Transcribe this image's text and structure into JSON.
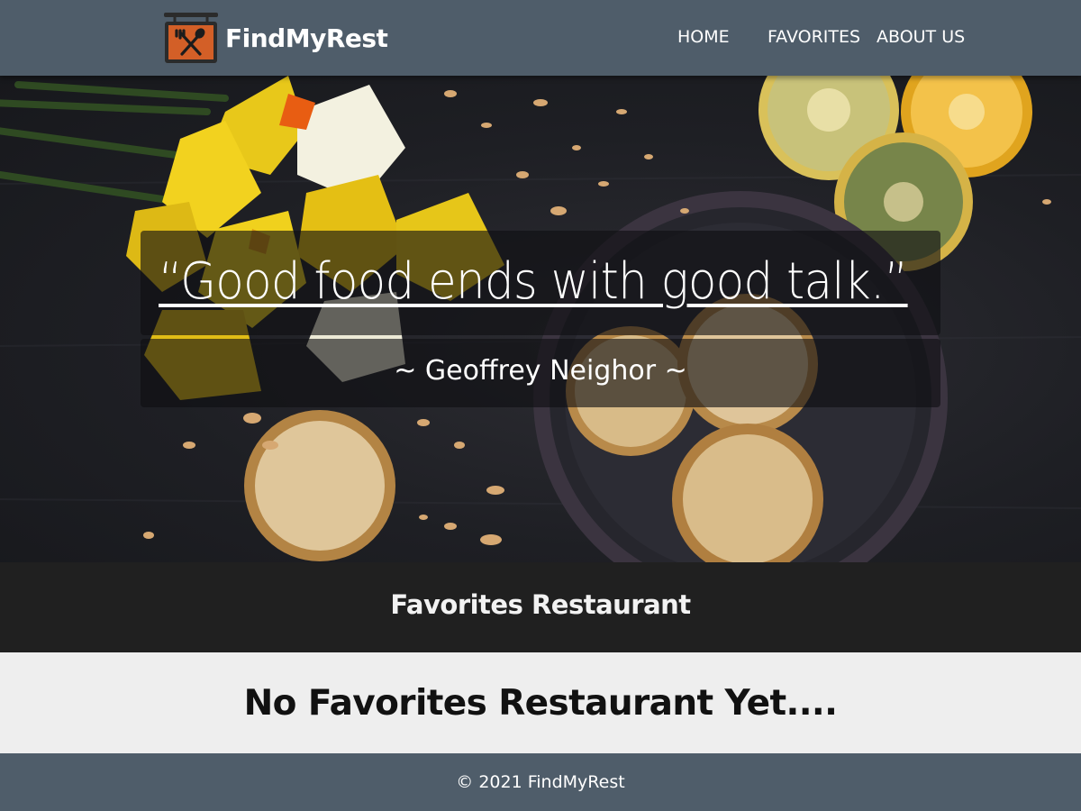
{
  "navbar": {
    "brand": "FindMyRest",
    "logo_icon": "fork-spoon-sign-icon",
    "links": [
      "HOME",
      "FAVORITES",
      "ABOUT US"
    ]
  },
  "hero": {
    "quote": "“Good food ends with good talk.”",
    "author": "~ Geoffrey Neighor ~"
  },
  "section": {
    "title": "Favorites Restaurant"
  },
  "content": {
    "empty_message": "No Favorites Restaurant Yet...."
  },
  "footer": {
    "copyright": "© 2021 FindMyRest"
  },
  "colors": {
    "navbar": "#4f5d6a",
    "section_bar": "#202020",
    "content_bg": "#eeeeee",
    "logo_orange": "#d35f27"
  }
}
